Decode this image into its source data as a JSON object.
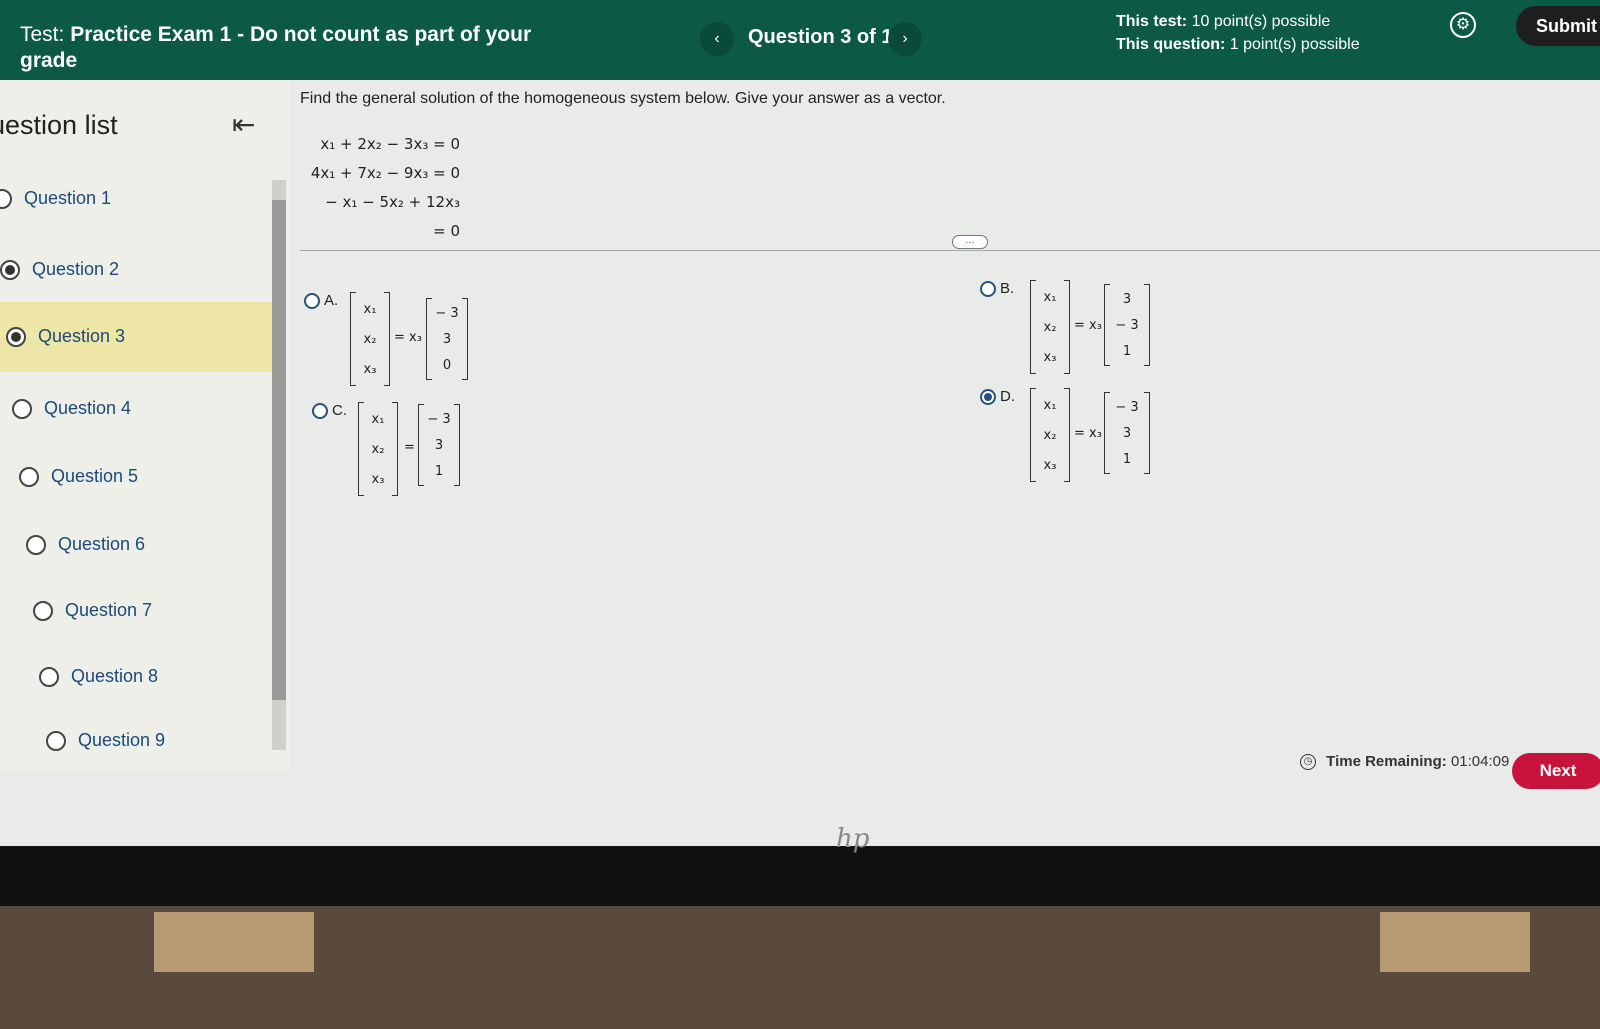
{
  "header": {
    "test_label": "Test:",
    "test_title": "Practice Exam 1 - Do not count as part of your grade",
    "prev_icon": "‹",
    "next_icon": "›",
    "question_counter": "Question 3 of 10",
    "test_points_label": "This test:",
    "test_points": "10 point(s) possible",
    "question_points_label": "This question:",
    "question_points": "1 point(s) possible",
    "settings_icon": "⚙",
    "submit_label": "Submit"
  },
  "sidebar": {
    "title": "uestion list",
    "collapse_icon": "⇤",
    "items": [
      {
        "label": "Question 1",
        "answered": false
      },
      {
        "label": "Question 2",
        "answered": true
      },
      {
        "label": "Question 3",
        "answered": true,
        "active": true
      },
      {
        "label": "Question 4",
        "answered": false
      },
      {
        "label": "Question 5",
        "answered": false
      },
      {
        "label": "Question 6",
        "answered": false
      },
      {
        "label": "Question 7",
        "answered": false
      },
      {
        "label": "Question 8",
        "answered": false
      },
      {
        "label": "Question 9",
        "answered": false
      }
    ]
  },
  "question": {
    "prompt": "Find the general solution of the homogeneous system below. Give your answer as a vector.",
    "equations": [
      "x₁ + 2x₂ − 3x₃ = 0",
      "4x₁ + 7x₂ − 9x₃ = 0",
      "− x₁ − 5x₂ + 12x₃ = 0"
    ],
    "more_label": "…",
    "options": {
      "A": {
        "label": "A.",
        "lhs": [
          "x₁",
          "x₂",
          "x₃"
        ],
        "eq": "= x₃",
        "rhs": [
          "− 3",
          "3",
          "0"
        ],
        "selected": false
      },
      "B": {
        "label": "B.",
        "lhs": [
          "x₁",
          "x₂",
          "x₃"
        ],
        "eq": "= x₃",
        "rhs": [
          "3",
          "− 3",
          "1"
        ],
        "selected": false
      },
      "C": {
        "label": "C.",
        "lhs": [
          "x₁",
          "x₂",
          "x₃"
        ],
        "eq": "=",
        "rhs": [
          "− 3",
          "3",
          "1"
        ],
        "selected": false
      },
      "D": {
        "label": "D.",
        "lhs": [
          "x₁",
          "x₂",
          "x₃"
        ],
        "eq": "= x₃",
        "rhs": [
          "− 3",
          "3",
          "1"
        ],
        "selected": true
      }
    }
  },
  "footer": {
    "clock_icon": "◷",
    "time_label": "Time Remaining:",
    "time_value": "01:04:09",
    "next_label": "Next"
  },
  "device": {
    "logo": "hp"
  }
}
